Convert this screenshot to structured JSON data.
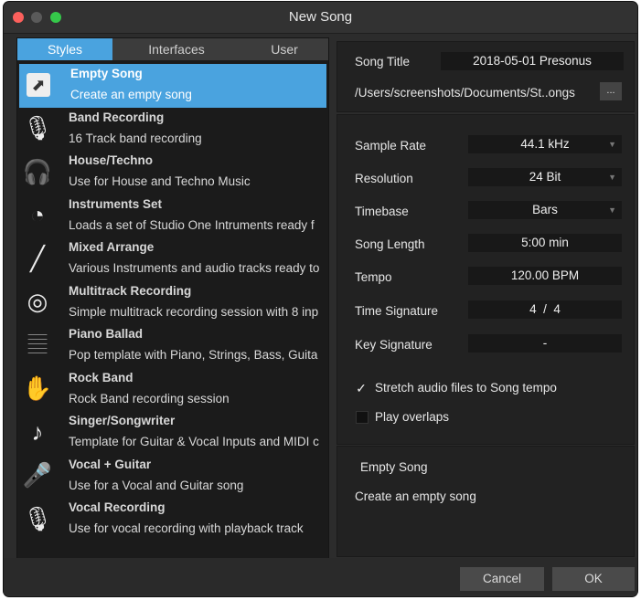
{
  "window": {
    "title": "New Song"
  },
  "tabs": [
    "Styles",
    "Interfaces",
    "User"
  ],
  "templates": [
    {
      "name": "Empty Song",
      "desc": "Create an empty song",
      "icon": "empty-song-icon",
      "glyph": "⬈"
    },
    {
      "name": "Band Recording",
      "desc": "16 Track band recording",
      "icon": "microphone-icon",
      "glyph": "🎙"
    },
    {
      "name": "House/Techno",
      "desc": "Use for House and Techno Music",
      "icon": "headphones-icon",
      "glyph": "🎧"
    },
    {
      "name": "Instruments Set",
      "desc": "Loads a set of  Studio One Intruments ready f",
      "icon": "knob-icon",
      "glyph": "◔"
    },
    {
      "name": "Mixed Arrange",
      "desc": "Various Instruments and audio tracks ready to",
      "icon": "cable-icon",
      "glyph": "╱"
    },
    {
      "name": "Multitrack Recording",
      "desc": "Simple multitrack recording session with 8 inp",
      "icon": "disc-icon",
      "glyph": "◎"
    },
    {
      "name": "Piano Ballad",
      "desc": "Pop template with Piano, Strings, Bass, Guita",
      "icon": "piano-keys-icon",
      "glyph": "𝄚"
    },
    {
      "name": "Rock Band",
      "desc": "Rock Band recording session",
      "icon": "rock-hand-icon",
      "glyph": "✋"
    },
    {
      "name": "Singer/Songwriter",
      "desc": "Template for Guitar & Vocal Inputs and MIDI c",
      "icon": "music-note-icon",
      "glyph": "♪"
    },
    {
      "name": "Vocal + Guitar",
      "desc": "Use for a Vocal and Guitar song",
      "icon": "handheld-mic-icon",
      "glyph": "🎤"
    },
    {
      "name": "Vocal Recording",
      "desc": "Use for vocal recording with playback track",
      "icon": "studio-mic-icon",
      "glyph": "🎙"
    }
  ],
  "song": {
    "title_label": "Song Title",
    "title_value": "2018-05-01 Presonus",
    "path": "/Users/screenshots/Documents/St..ongs",
    "browse_label": "..."
  },
  "settings": {
    "sample_rate_label": "Sample Rate",
    "sample_rate": "44.1 kHz",
    "resolution_label": "Resolution",
    "resolution": "24 Bit",
    "timebase_label": "Timebase",
    "timebase": "Bars",
    "length_label": "Song Length",
    "length": "5:00 min",
    "tempo_label": "Tempo",
    "tempo": "120.00 BPM",
    "timesig_label": "Time Signature",
    "timesig": "4  /  4",
    "keysig_label": "Key Signature",
    "keysig": "-",
    "stretch_label": "Stretch audio files to Song tempo",
    "stretch_checked": true,
    "overlaps_label": "Play overlaps",
    "overlaps_checked": false
  },
  "description": {
    "title": "Empty Song",
    "text": "Create an empty song"
  },
  "buttons": {
    "cancel": "Cancel",
    "ok": "OK"
  },
  "colors": {
    "accent": "#4aa3df",
    "background": "#2c2c2c"
  }
}
